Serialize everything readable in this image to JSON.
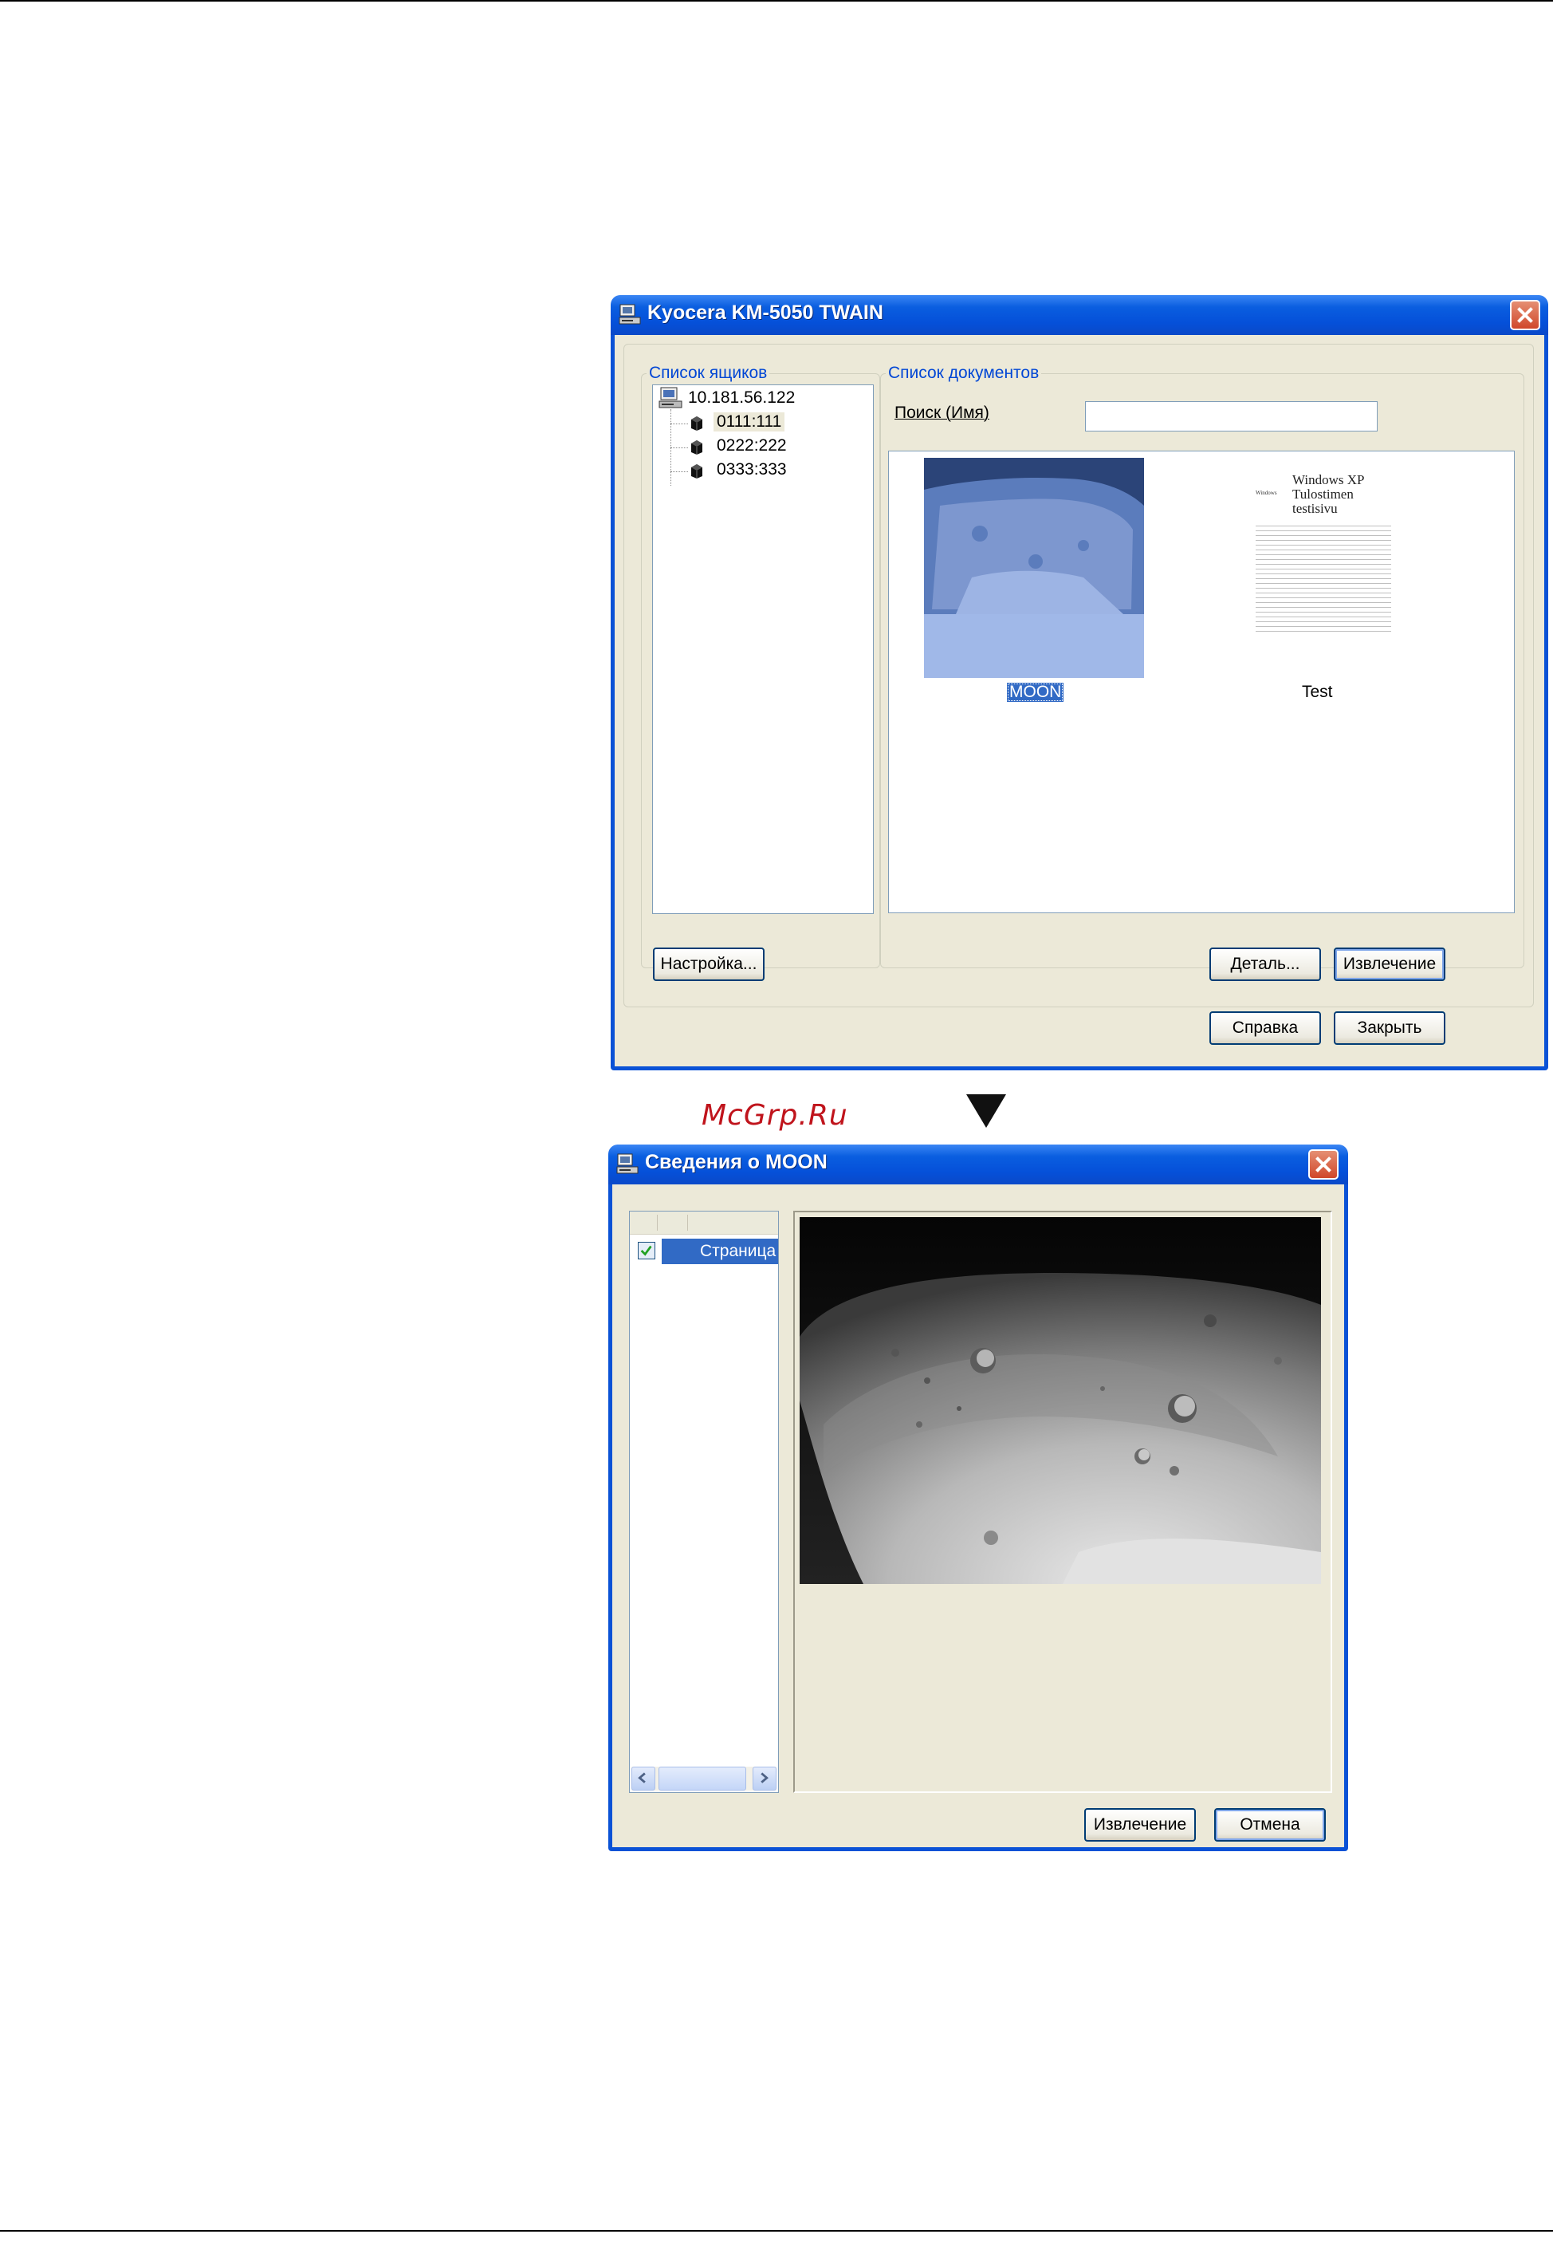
{
  "dialog1": {
    "title": "Kyocera KM-5050 TWAIN",
    "box_list_legend": "Список ящиков",
    "tree": {
      "root": "10.181.56.122",
      "items": [
        "0111:111",
        "0222:222",
        "0333:333"
      ]
    },
    "doc_list_legend": "Список документов",
    "search_label": "Поиск (Имя)",
    "search_value": "",
    "documents": [
      {
        "name": "MOON"
      },
      {
        "name": "Test",
        "preview_lines": [
          "Windows XP",
          "Tulostimen",
          "testisivu"
        ],
        "preview_logo": "Windows"
      }
    ],
    "buttons": {
      "settings": "Настройка...",
      "details": "Деталь...",
      "extract": "Извлечение",
      "help": "Справка",
      "close": "Закрыть"
    }
  },
  "watermark": "McGrp.Ru",
  "dialog2": {
    "title": "Сведения о MOON",
    "page_row_label": "Страница",
    "page_checked": true,
    "buttons": {
      "extract": "Извлечение",
      "cancel": "Отмена"
    }
  },
  "colors": {
    "titlebar": "#0550d9",
    "dialog_bg": "#ece9d8",
    "groupbox_text": "#0046d5",
    "selection": "#316ac5",
    "watermark": "#c0141c"
  }
}
